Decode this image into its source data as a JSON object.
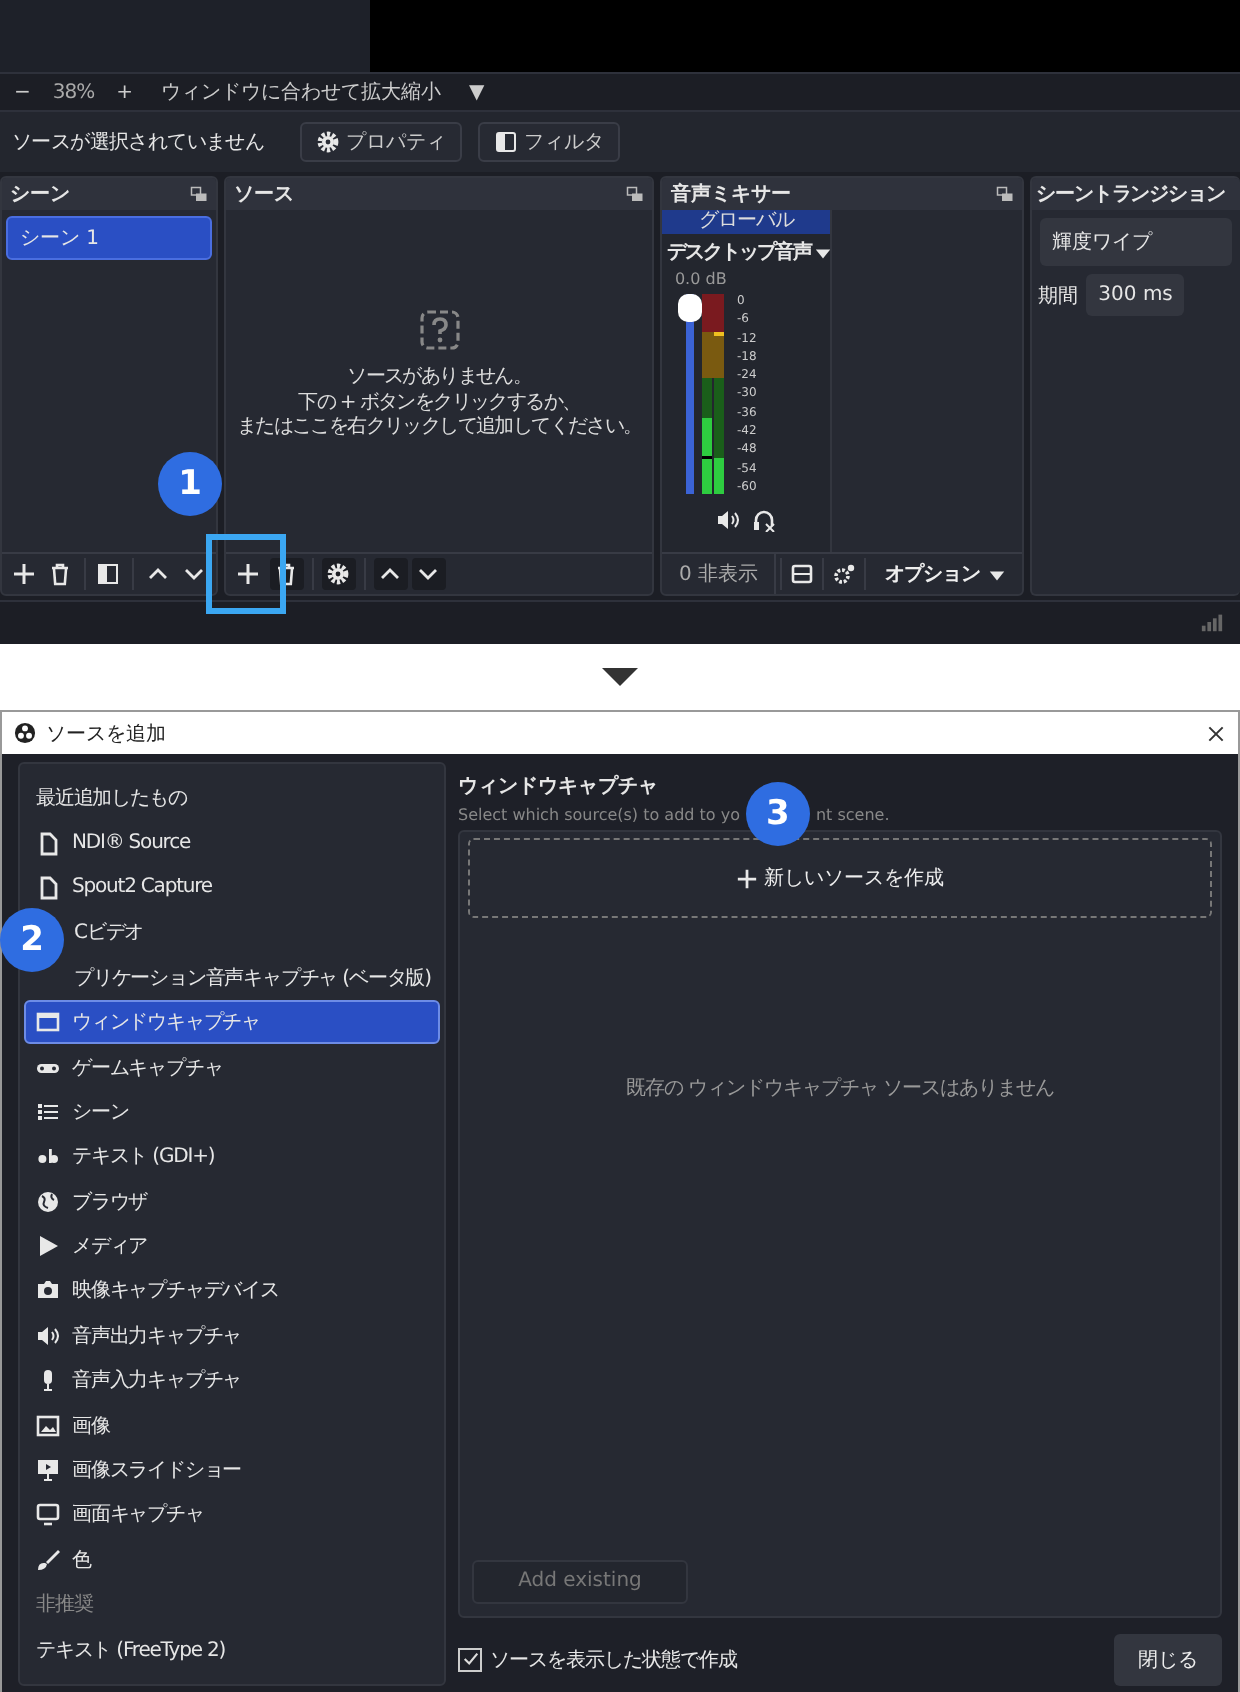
{
  "zoom_bar": {
    "zoom_out": "−",
    "zoom": "38%",
    "zoom_in": "+",
    "fit": "ウィンドウに合わせて拡大縮小",
    "menu": "▼"
  },
  "context_bar": {
    "status": "ソースが選択されていません",
    "buttons": [
      {
        "label": "プロパティ",
        "kind": "gear"
      },
      {
        "label": "フィルタ",
        "kind": "filter"
      }
    ]
  },
  "scenes": {
    "title": "シーン",
    "items": [
      {
        "label": "シーン 1",
        "selected": true
      }
    ]
  },
  "sources": {
    "title": "ソース",
    "empty_lines": [
      "ソースがありません。",
      "下の + ボタンをクリックするか、",
      "またはここを右クリックして追加してください。"
    ]
  },
  "mixer": {
    "title": "音声ミキサー",
    "global": "グローバル",
    "channel": "デスクトップ音声",
    "volume": "0.0 dB",
    "level": 1,
    "ticks": [
      "0",
      "-6",
      "-12",
      "-18",
      "-24",
      "-30",
      "-36",
      "-42",
      "-48",
      "-54",
      "-60"
    ],
    "hidden": "0 非表示",
    "options": "オプション"
  },
  "transitions": {
    "title": "シーントランジション",
    "transition": "輝度ワイプ",
    "duration_label": "期間",
    "duration": "300 ms"
  },
  "callouts": [
    "1",
    "2",
    "3"
  ],
  "dialog": {
    "title": "ソースを追加",
    "items": [
      {
        "label": "最近追加したもの",
        "kind": "header",
        "selected": false
      },
      {
        "label": "NDI® Source",
        "kind": "file",
        "selected": false
      },
      {
        "label": "Spout2 Capture",
        "kind": "file",
        "selected": false
      },
      {
        "label": "Cビデオ",
        "kind": "covered",
        "selected": false
      },
      {
        "label": "プリケーション音声キャプチャ (ベータ版)",
        "kind": "covered",
        "selected": false
      },
      {
        "label": "ウィンドウキャプチャ",
        "kind": "window",
        "selected": true
      },
      {
        "label": "ゲームキャプチャ",
        "kind": "gamepad",
        "selected": false
      },
      {
        "label": "シーン",
        "kind": "list",
        "selected": false
      },
      {
        "label": "テキスト (GDI+)",
        "kind": "text",
        "selected": false
      },
      {
        "label": "ブラウザ",
        "kind": "globe",
        "selected": false
      },
      {
        "label": "メディア",
        "kind": "play",
        "selected": false
      },
      {
        "label": "映像キャプチャデバイス",
        "kind": "camera",
        "selected": false
      },
      {
        "label": "音声出力キャプチャ",
        "kind": "speaker",
        "selected": false
      },
      {
        "label": "音声入力キャプチャ",
        "kind": "mic",
        "selected": false
      },
      {
        "label": "画像",
        "kind": "image",
        "selected": false
      },
      {
        "label": "画像スライドショー",
        "kind": "slideshow",
        "selected": false
      },
      {
        "label": "画面キャプチャ",
        "kind": "monitor",
        "selected": false
      },
      {
        "label": "色",
        "kind": "brush",
        "selected": false
      },
      {
        "label": "非推奨",
        "kind": "deprecated",
        "selected": false
      },
      {
        "label": "テキスト (FreeType 2)",
        "kind": "plain",
        "selected": false
      }
    ],
    "heading": "ウィンドウキャプチャ",
    "subtitle_start": "Select which source(s) to add to yo",
    "subtitle_end": "nt scene.",
    "new_source": "新しいソースを作成",
    "empty_text": "既存の ウィンドウキャプチャ ソースはありません",
    "add_existing": "Add existing",
    "add_existing_disabled": true,
    "visible_checkbox": {
      "label": "ソースを表示した状態で作成",
      "checked": true
    },
    "close": "閉じる"
  }
}
